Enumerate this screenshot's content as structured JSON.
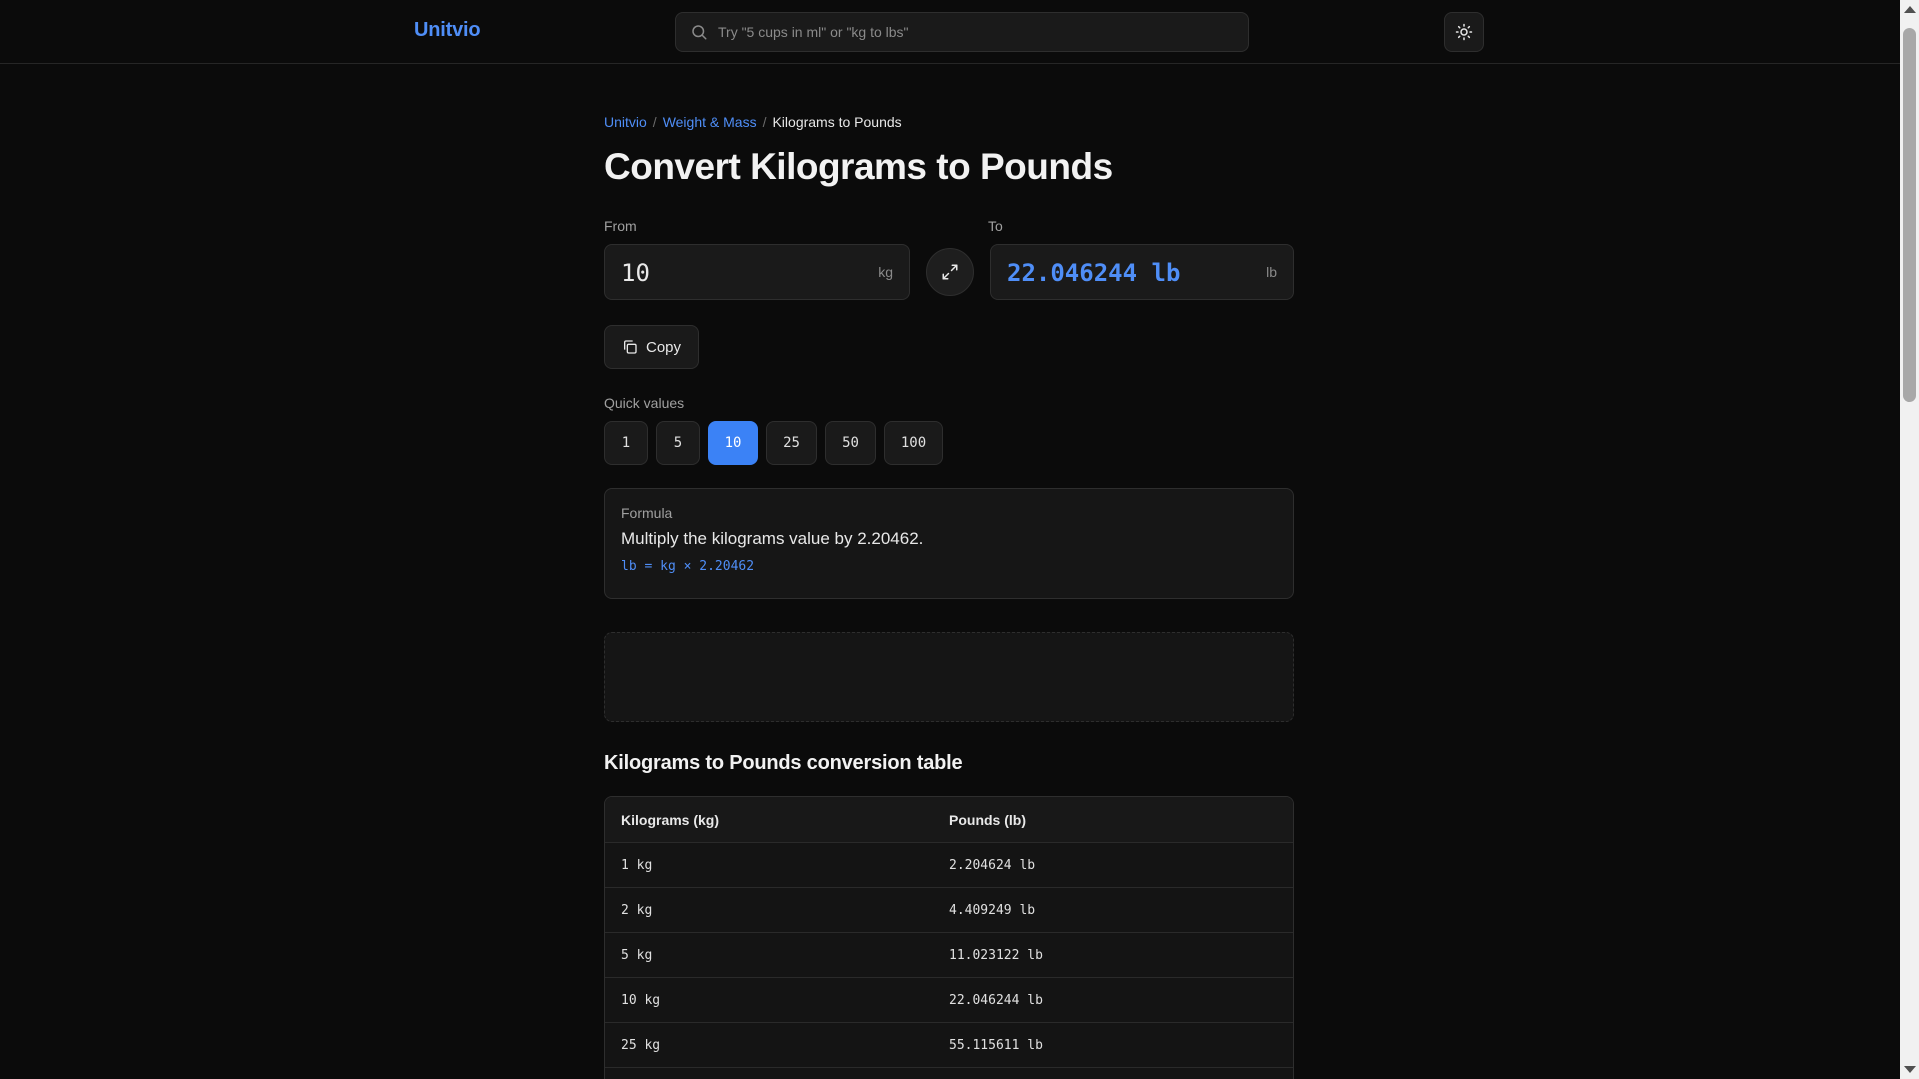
{
  "header": {
    "brand": "Unitvio",
    "search_placeholder": "Try \"5 cups in ml\" or \"kg to lbs\""
  },
  "breadcrumb": {
    "home": "Unitvio",
    "category": "Weight & Mass",
    "current": "Kilograms to Pounds",
    "separator": "/"
  },
  "page_title": "Convert Kilograms to Pounds",
  "converter": {
    "from_label": "From",
    "from_value": "10",
    "from_unit": "kg",
    "to_label": "To",
    "to_value": "22.046244 lb",
    "to_unit": "lb",
    "copy_label": "Copy"
  },
  "quick_values": {
    "label": "Quick values",
    "items": [
      "1",
      "5",
      "10",
      "25",
      "50",
      "100"
    ],
    "selected": "10"
  },
  "formula": {
    "label": "Formula",
    "text": "Multiply the kilograms value by 2.20462.",
    "code": "lb = kg × 2.20462"
  },
  "table": {
    "title": "Kilograms to Pounds conversion table",
    "headers": [
      "Kilograms (kg)",
      "Pounds (lb)"
    ],
    "rows": [
      [
        "1 kg",
        "2.204624 lb"
      ],
      [
        "2 kg",
        "4.409249 lb"
      ],
      [
        "5 kg",
        "11.023122 lb"
      ],
      [
        "10 kg",
        "22.046244 lb"
      ],
      [
        "25 kg",
        "55.115611 lb"
      ]
    ]
  },
  "colors": {
    "accent": "#4f8ef7",
    "active_chip": "#3b82f6",
    "background": "#0b0b0b"
  },
  "icons": {
    "search": "search-icon",
    "theme": "sun-icon",
    "swap": "swap-arrows-icon",
    "copy": "copy-icon"
  }
}
